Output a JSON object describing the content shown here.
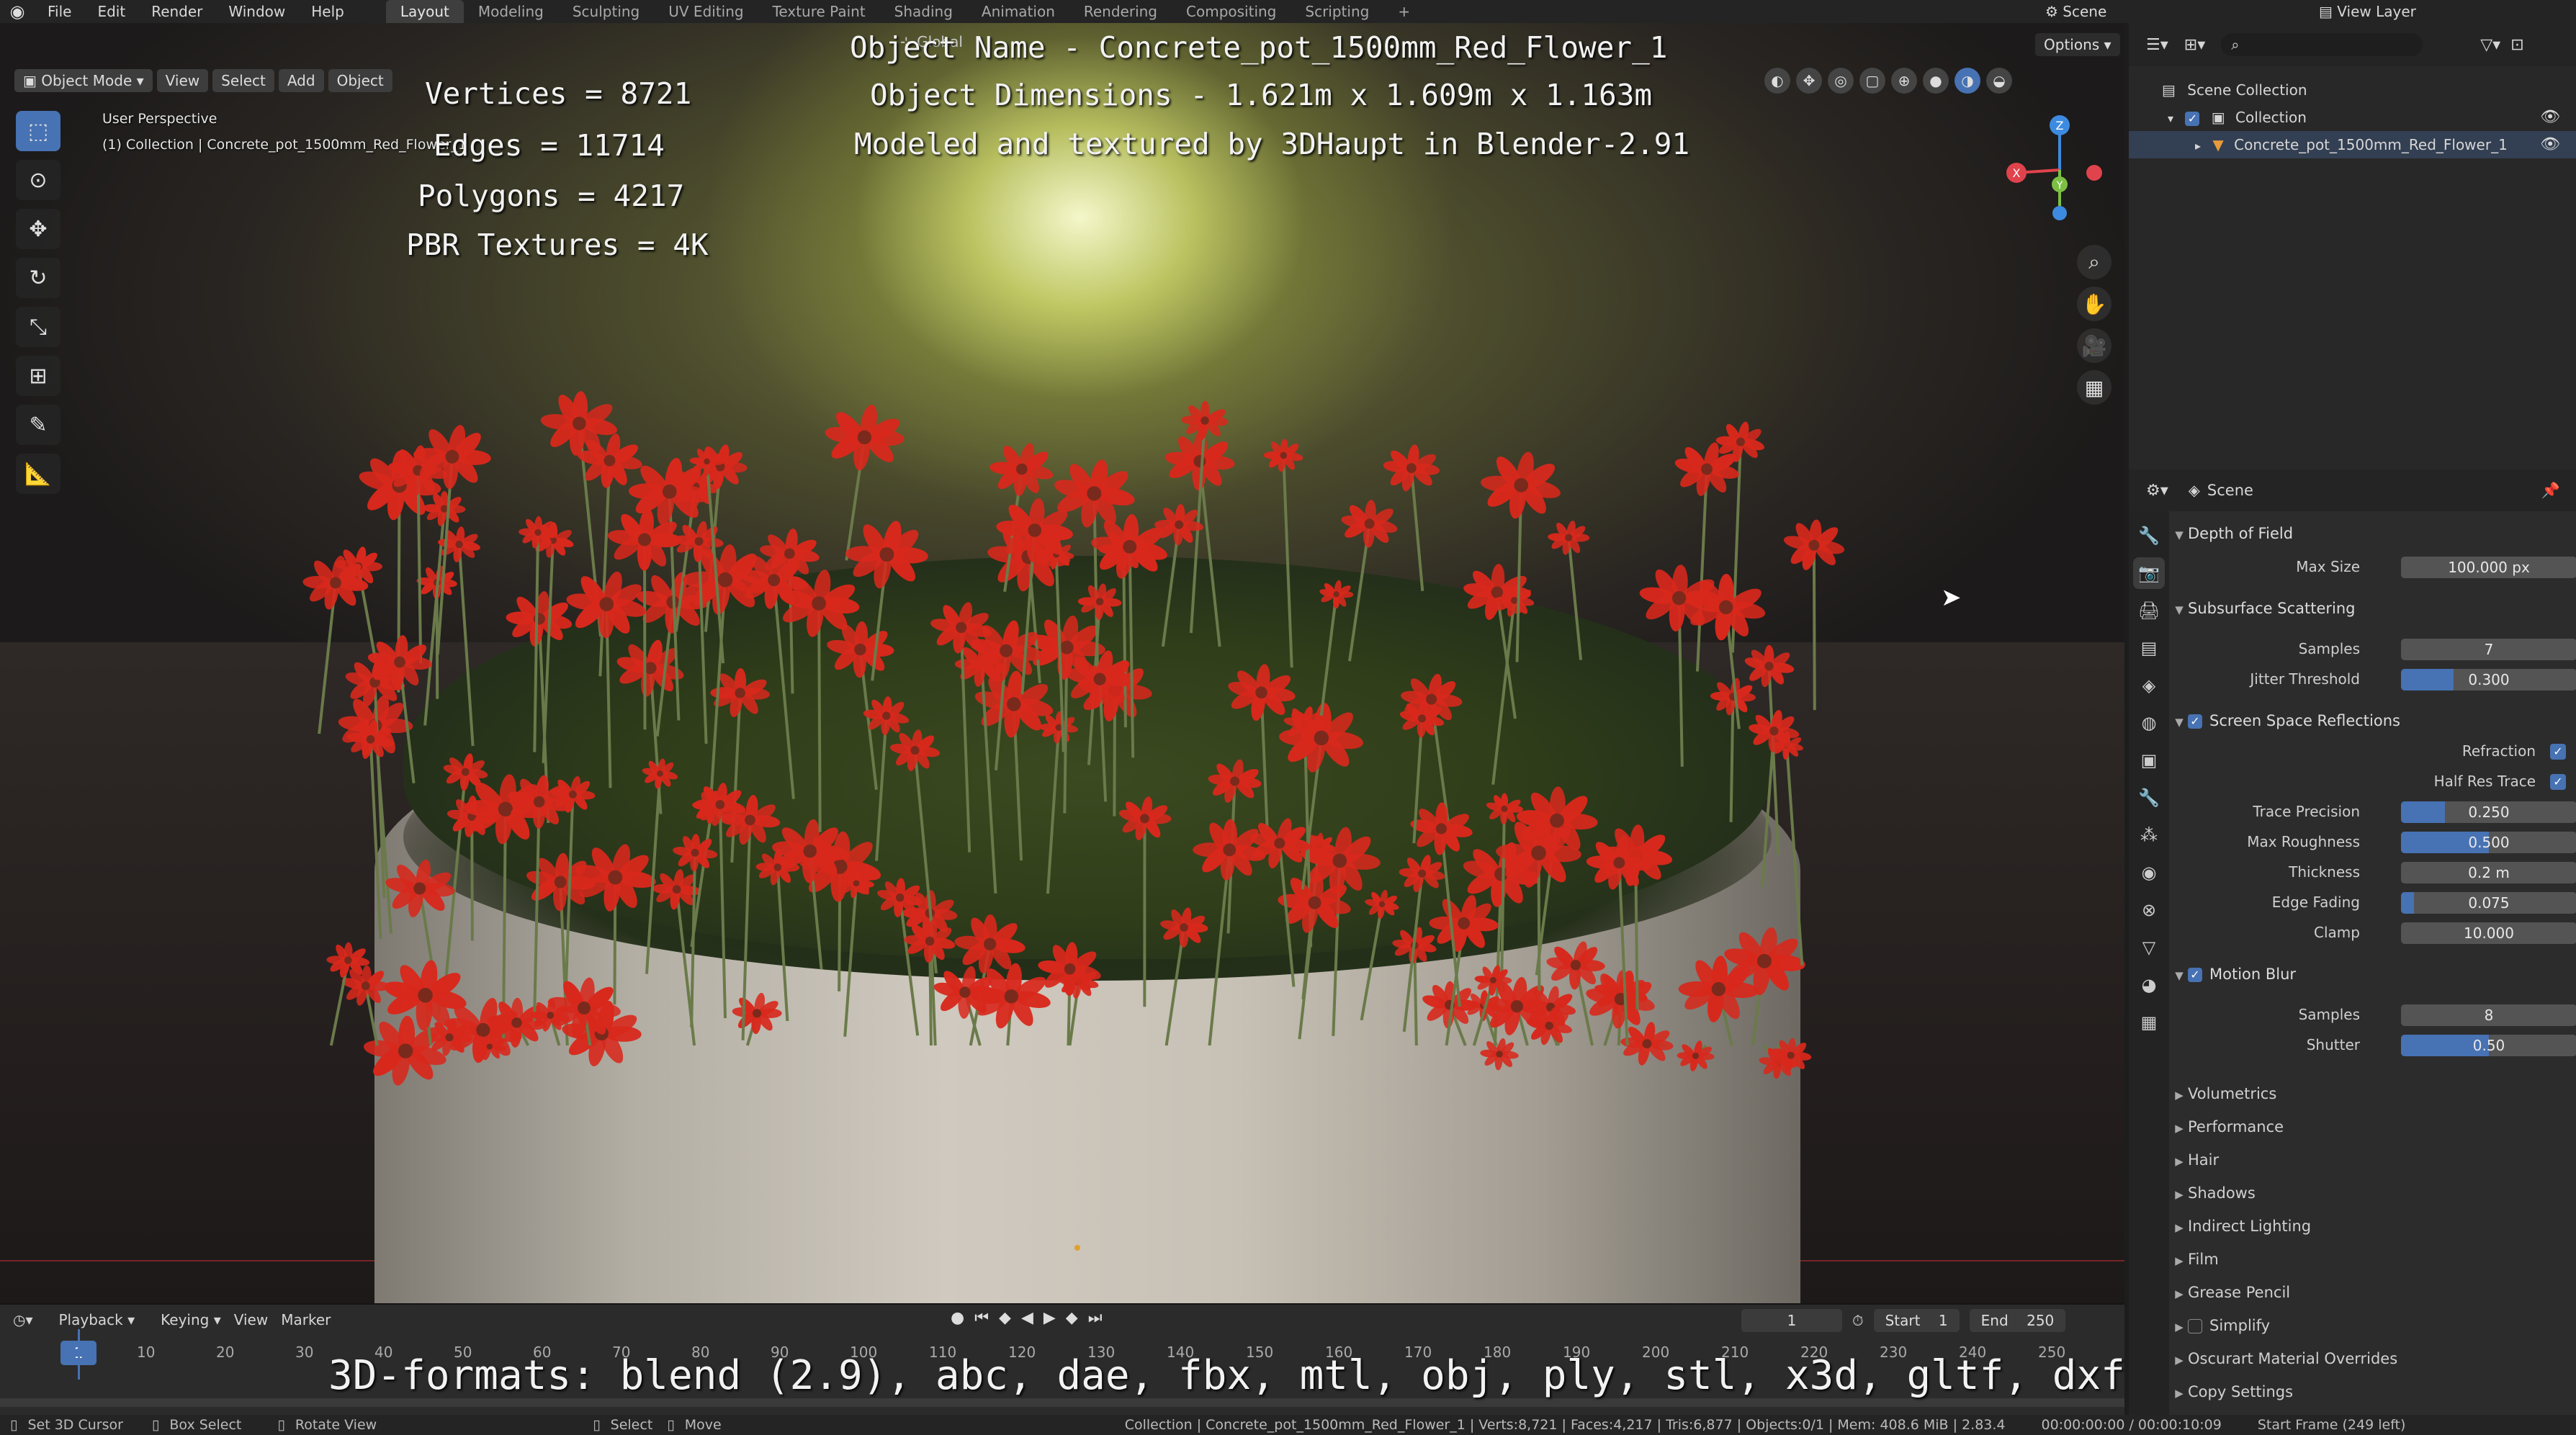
{
  "topbar": {
    "menus": [
      "File",
      "Edit",
      "Render",
      "Window",
      "Help"
    ],
    "workspaces": [
      "Layout",
      "Modeling",
      "Sculpting",
      "UV Editing",
      "Texture Paint",
      "Shading",
      "Animation",
      "Rendering",
      "Compositing",
      "Scripting"
    ],
    "active_workspace": "Layout",
    "add_workspace": "+",
    "scene": "Scene",
    "view_layer": "View Layer"
  },
  "viewport": {
    "mode": "Object Mode",
    "menus": [
      "View",
      "Select",
      "Add",
      "Object"
    ],
    "orientation": "Global",
    "options": "Options",
    "perspective": "User Perspective",
    "collection_path": "(1) Collection | Concrete_pot_1500mm_Red_Flower_1",
    "overlay": {
      "object_name": "Object Name - Concrete_pot_1500mm_Red_Flower_1",
      "dimensions": "Object Dimensions -  1.621m x 1.609m x 1.163m",
      "credit": "Modeled and textured by 3DHaupt in Blender-2.91",
      "vertices": "Vertices = 8721",
      "edges": "Edges = 11714",
      "polygons": "Polygons = 4217",
      "textures": "PBR Textures = 4K"
    },
    "gizmo": {
      "x": "X",
      "y": "Y",
      "z": "Z"
    }
  },
  "timeline": {
    "menus": [
      "Playback",
      "Keying",
      "View",
      "Marker"
    ],
    "current_frame": "1",
    "frame_display": "1",
    "start_label": "Start",
    "start": "1",
    "end_label": "End",
    "end": "250",
    "ticks": [
      "10",
      "20",
      "30",
      "40",
      "50",
      "60",
      "70",
      "80",
      "90",
      "100",
      "110",
      "120",
      "130",
      "140",
      "150",
      "160",
      "170",
      "180",
      "190",
      "200",
      "210",
      "220",
      "230",
      "240",
      "250"
    ],
    "formats": "3D-formats: blend (2.9), abc, dae, fbx, mtl, obj, ply, stl, x3d, gltf, dxf"
  },
  "statusbar": {
    "items": [
      "Set 3D Cursor",
      "Box Select",
      "Rotate View",
      "Select",
      "Move"
    ],
    "stats": "Collection | Concrete_pot_1500mm_Red_Flower_1 | Verts:8,721 | Faces:4,217 | Tris:6,877 | Objects:0/1 | Mem: 408.6 MiB | 2.83.4",
    "time": "00:00:00:00 / 00:00:10:09",
    "frames_left": "Start Frame (249 left)"
  },
  "outliner": {
    "scene_collection": "Scene Collection",
    "collection": "Collection",
    "object": "Concrete_pot_1500mm_Red_Flower_1"
  },
  "properties": {
    "context": "Scene",
    "sections": {
      "dof": {
        "title": "Depth of Field",
        "max_size_label": "Max Size",
        "max_size": "100.000 px"
      },
      "sss": {
        "title": "Subsurface Scattering",
        "samples_label": "Samples",
        "samples": "7",
        "jitter_label": "Jitter Threshold",
        "jitter": "0.300",
        "jitter_fraction": 0.3
      },
      "ssr": {
        "title": "Screen Space Reflections",
        "refraction_label": "Refraction",
        "half_res_label": "Half Res Trace",
        "trace_precision_label": "Trace Precision",
        "trace_precision": "0.250",
        "trace_precision_fraction": 0.25,
        "max_roughness_label": "Max Roughness",
        "max_roughness": "0.500",
        "max_roughness_fraction": 0.5,
        "thickness_label": "Thickness",
        "thickness": "0.2 m",
        "edge_fading_label": "Edge Fading",
        "edge_fading": "0.075",
        "edge_fading_fraction": 0.075,
        "clamp_label": "Clamp",
        "clamp": "10.000"
      },
      "motion_blur": {
        "title": "Motion Blur",
        "samples_label": "Samples",
        "samples": "8",
        "shutter_label": "Shutter",
        "shutter": "0.50",
        "shutter_fraction": 0.5
      },
      "collapsed": [
        "Volumetrics",
        "Performance",
        "Hair",
        "Shadows",
        "Indirect Lighting",
        "Film",
        "Grease Pencil",
        "Simplify",
        "Oscurart Material Overrides",
        "Copy Settings"
      ]
    }
  },
  "colors": {
    "accent": "#4772b3",
    "flower": "#d8281c",
    "axis_x": "#e0434c",
    "axis_y": "#7bc043",
    "axis_z": "#3d8be0"
  }
}
